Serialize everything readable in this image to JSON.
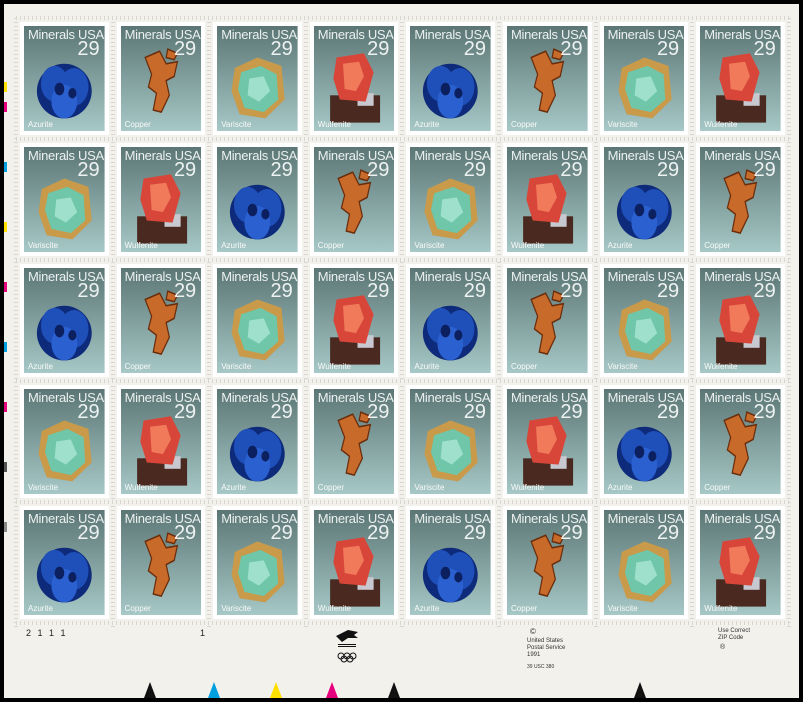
{
  "stamp_title": "Minerals USA",
  "denomination": "29",
  "mineral_names": [
    "Azurite",
    "Copper",
    "Variscite",
    "Wulfenite"
  ],
  "rows": [
    [
      "Azurite",
      "Copper",
      "Variscite",
      "Wulfenite",
      "Azurite",
      "Copper",
      "Variscite",
      "Wulfenite"
    ],
    [
      "Variscite",
      "Wulfenite",
      "Azurite",
      "Copper",
      "Variscite",
      "Wulfenite",
      "Azurite",
      "Copper"
    ],
    [
      "Azurite",
      "Copper",
      "Variscite",
      "Wulfenite",
      "Azurite",
      "Copper",
      "Variscite",
      "Wulfenite"
    ],
    [
      "Variscite",
      "Wulfenite",
      "Azurite",
      "Copper",
      "Variscite",
      "Wulfenite",
      "Azurite",
      "Copper"
    ],
    [
      "Azurite",
      "Copper",
      "Variscite",
      "Wulfenite",
      "Azurite",
      "Copper",
      "Variscite",
      "Wulfenite"
    ]
  ],
  "margin": {
    "plate_number": "2 1 1 1",
    "plate_mark": "1",
    "copyright_symbol": "©",
    "copyright_lines": [
      "United States",
      "Postal Service",
      "1991"
    ],
    "usc_note": "39 USC 380",
    "zip_lines": [
      "Use Correct",
      "ZIP Code"
    ],
    "zip_mark": "®"
  },
  "colors": {
    "stamp_bg_top": "#5b7675",
    "stamp_bg_bottom": "#a6c8c6",
    "azurite": "#1f4fb8",
    "copper": "#c86a2a",
    "variscite": "#6fc6a8",
    "wulfenite": "#d8463a",
    "registration": [
      "#e6007e",
      "#ffe000",
      "#00a0e0",
      "#111111"
    ]
  }
}
